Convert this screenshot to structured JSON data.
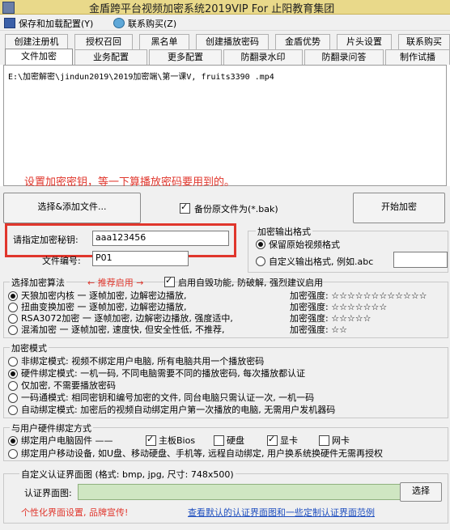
{
  "window": {
    "title": "金盾跨平台视频加密系统2019VIP For 止阳教育集团"
  },
  "menu": {
    "items": [
      "保存和加载配置(Y)",
      "联系购买(Z)"
    ]
  },
  "tabs": {
    "row1": [
      "创建注册机",
      "授权召回",
      "黑名单",
      "创建播放密码",
      "金盾优势",
      "片头设置",
      "联系购买"
    ],
    "row2": [
      "文件加密",
      "业务配置",
      "更多配置",
      "防翻录水印",
      "防翻录问答",
      "制作试播"
    ],
    "active": "文件加密"
  },
  "file_list": {
    "path": "E:\\加密解密\\jindun2019\\2019加密端\\第一课V, fruits3390 .mp4"
  },
  "annotation": {
    "hint": "设置加密密钥，等一下算播放密码要用到的。"
  },
  "actions": {
    "select_add": "选择&添加文件...",
    "backup": "备份原文件为(*.bak)",
    "start": "开始加密"
  },
  "key_field": {
    "label": "请指定加密秘钥:",
    "value": "aaa123456"
  },
  "file_number": {
    "label": "文件编号:",
    "value": "P01"
  },
  "output_format": {
    "title": "加密输出格式",
    "keep": "保留原始视频格式",
    "custom": "自定义输出格式, 例如.abc",
    "custom_value": ""
  },
  "algorithm": {
    "title": "选择加密算法",
    "recommend": "← 推荐启用 →",
    "self_destruct": "启用自毁功能, 防破解, 强烈建议启用",
    "options": [
      {
        "name": "天狼加密内核 一 逐帧加密, 边解密边播放,",
        "strength": "加密强度: ☆☆☆☆☆☆☆☆☆☆☆☆"
      },
      {
        "name": "扭曲变换加密 一 逐帧加密, 边解密边播放,",
        "strength": "加密强度: ☆☆☆☆☆☆☆"
      },
      {
        "name": "RSA3072加密 一 逐帧加密, 边解密边播放, 强度适中,",
        "strength": "加密强度: ☆☆☆☆☆"
      },
      {
        "name": "混淆加密 一 逐帧加密, 速度快, 但安全性低, 不推荐,",
        "strength": "加密强度: ☆☆"
      }
    ]
  },
  "encrypt_mode": {
    "title": "加密模式",
    "options": [
      "非绑定模式: 视频不绑定用户电脑, 所有电脑共用一个播放密码",
      "硬件绑定模式: 一机一码, 不同电脑需要不同的播放密码, 每次播放都认证",
      "仅加密, 不需要播放密码",
      "一码通模式: 相同密钥和编号加密的文件, 同台电脑只需认证一次, 一机一码",
      "自动绑定模式: 加密后的视频自动绑定用户第一次播放的电脑, 无需用户发机器码"
    ]
  },
  "hardware_bind": {
    "title": "与用户硬件绑定方式",
    "row1_label": "绑定用户电脑固件 ——",
    "mainboard": "主板Bios",
    "disk": "硬盘",
    "gpu": "显卡",
    "nic": "网卡",
    "row2_label": "绑定用户移动设备, 如U盘、移动硬盘、手机等, 远程自动绑定, 用户换系统换硬件无需再授权"
  },
  "custom_auth": {
    "title": "自定义认证界面图 (格式: bmp, jpg, 尺寸: 748x500)",
    "label": "认证界面图:",
    "select": "选择",
    "promo": "个性化界面设置, 品牌宣传!",
    "link": "查看默认的认证界面图和一些定制认证界面范例"
  },
  "colors": {
    "accent_red": "#e0362c",
    "link_blue": "#1f4fbf",
    "title_bar": "#e9d98a"
  }
}
